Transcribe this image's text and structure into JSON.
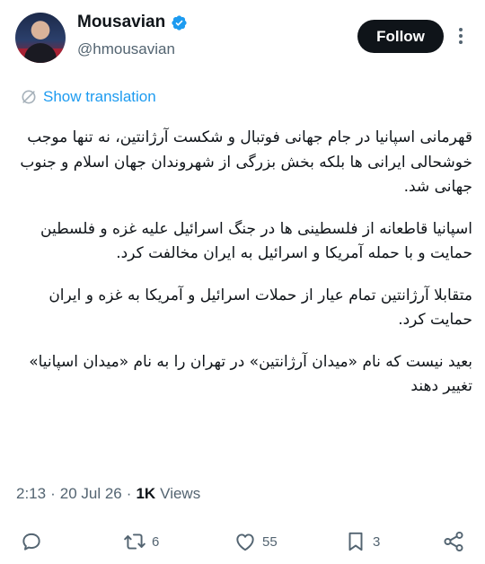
{
  "author": {
    "name": "Mousavian",
    "handle": "@hmousavian",
    "verified": true
  },
  "follow_label": "Follow",
  "translate_label": "Show translation",
  "tweet": {
    "paragraphs": [
      "قهرمانی اسپانیا در جام جهانی فوتبال و شکست آرژانتین، نه تنها موجب خوشحالی ایرانی ها بلکه بخش بزرگی از شهروندان جهان اسلام و جنوب جهانی شد.",
      "اسپانیا قاطعانه از فلسطینی ها در جنگ اسرائیل علیه غزه و فلسطین حمایت و با حمله آمریکا و اسرائیل به ایران مخالفت کرد.",
      "متقابلا آرژانتین تمام عیار از حملات اسرائیل و آمریکا به غزه و ایران حمایت کرد.",
      "بعید نیست که نام «میدان آرژانتین» در تهران را به نام «میدان اسپانیا» تغییر دهند"
    ]
  },
  "meta": {
    "time": "2:13",
    "date": "20 Jul 26",
    "separator": "·",
    "views_count": "1K",
    "views_label": "Views"
  },
  "actions": {
    "reply_count": "",
    "retweet_count": "6",
    "like_count": "55",
    "bookmark_count": "3"
  },
  "colors": {
    "accent": "#1d9bf0",
    "text": "#0f1419",
    "secondary": "#536471",
    "follow_bg": "#0f1419"
  },
  "icons": [
    "verified-badge-icon",
    "more-icon",
    "translate-icon",
    "reply-icon",
    "retweet-icon",
    "like-icon",
    "bookmark-icon",
    "share-icon"
  ]
}
